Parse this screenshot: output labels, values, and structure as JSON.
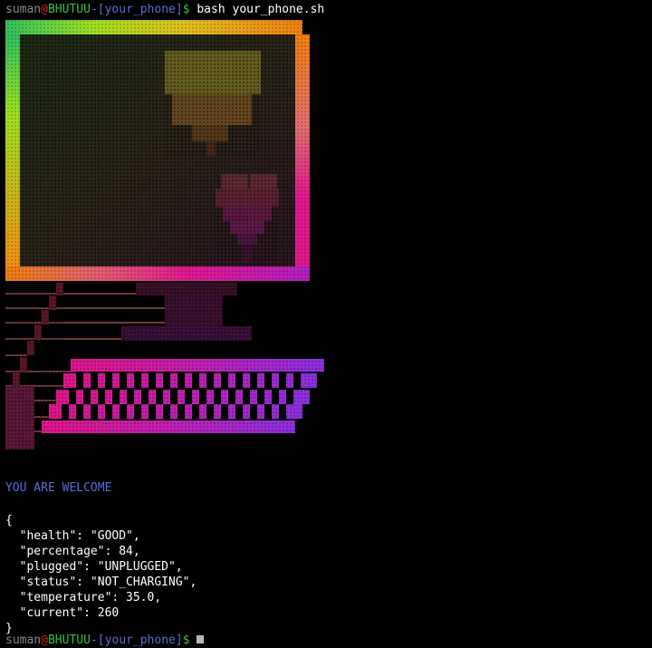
{
  "prompt": {
    "user": "suman",
    "at": "@",
    "host": "BHUTUU",
    "dir_open": "-[",
    "dir": "your_phone",
    "dir_close": "]",
    "dollar": "$",
    "command": " bash your_phone.sh"
  },
  "welcome_text": "YOU ARE WELCOME",
  "json_output": {
    "open_brace": "{",
    "lines": [
      "  \"health\": \"GOOD\",",
      "  \"percentage\": 84,",
      "  \"plugged\": \"UNPLUGGED\",",
      "  \"status\": \"NOT_CHARGING\",",
      "  \"temperature\": 35.0,",
      "  \"current\": 260"
    ],
    "close_brace": "}"
  },
  "battery": {
    "health": "GOOD",
    "percentage": 84,
    "plugged": "UNPLUGGED",
    "status": "NOT_CHARGING",
    "temperature": 35.0,
    "current": 260
  },
  "colors": {
    "background": "#000000",
    "prompt_user": "#8a8a8a",
    "prompt_at": "#d02020",
    "prompt_host": "#30c040",
    "prompt_dir": "#5d6bd8",
    "welcome": "#5d6bd8",
    "frame_gradient": [
      "#30c060",
      "#a0e020",
      "#e0c020",
      "#f08010",
      "#e06080",
      "#e01890",
      "#b020c0"
    ],
    "keyboard_gradient": [
      "#e0158a",
      "#c020b0",
      "#8a30e0"
    ],
    "screen_fill": "#2a2418"
  },
  "art_description_icons": [
    "computer-monitor-icon",
    "heart-icon",
    "keyboard-icon"
  ]
}
